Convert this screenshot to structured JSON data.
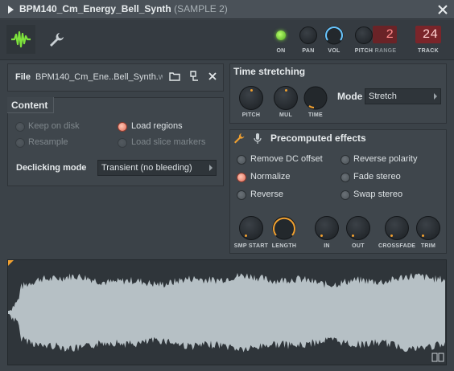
{
  "window": {
    "title": "BPM140_Cm_Energy_Bell_Synth",
    "subtitle": "(SAMPLE 2)"
  },
  "toolbar": {
    "on_label": "ON",
    "pan_label": "PAN",
    "vol_label": "VOL",
    "pitch_label": "PITCH",
    "range_label": "RANGE",
    "range_value": "2",
    "track_label": "TRACK",
    "track_value": "24"
  },
  "file": {
    "label": "File",
    "name": "BPM140_Cm_Ene..Bell_Synth.",
    "ext": "wav"
  },
  "content": {
    "title": "Content",
    "options": {
      "keep_on_disk": "Keep on disk",
      "resample": "Resample",
      "load_regions": "Load regions",
      "load_slice_markers": "Load slice markers"
    },
    "declicking_label": "Declicking mode",
    "declicking_value": "Transient (no bleeding)"
  },
  "time_stretching": {
    "title": "Time stretching",
    "pitch_label": "PITCH",
    "mul_label": "MUL",
    "time_label": "TIME",
    "mode_label": "Mode",
    "mode_value": "Stretch"
  },
  "precomputed": {
    "title": "Precomputed effects",
    "options": {
      "remove_dc": "Remove DC offset",
      "normalize": "Normalize",
      "reverse": "Reverse",
      "reverse_polarity": "Reverse polarity",
      "fade_stereo": "Fade stereo",
      "swap_stereo": "Swap stereo"
    },
    "knobs": {
      "smp_start": "SMP START",
      "length": "LENGTH",
      "in": "IN",
      "out": "OUT",
      "crossfade": "CROSSFADE",
      "trim": "TRIM"
    }
  },
  "colors": {
    "accent_green": "#7de23c",
    "accent_orange": "#f0a030",
    "radio_on": "#e06e5a",
    "waveform": "#b6c0c5"
  }
}
